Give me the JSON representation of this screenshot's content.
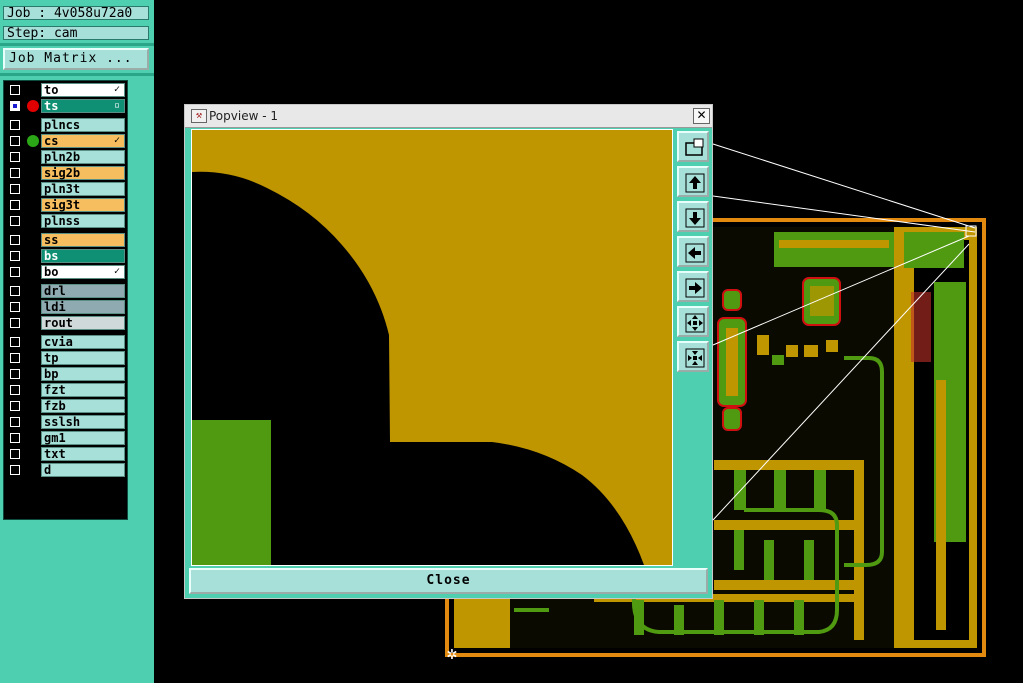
{
  "header": {
    "job": "Job : 4v058u72a0",
    "step": "Step: cam",
    "job_matrix_label": "Job Matrix ..."
  },
  "layers": [
    {
      "name": "to",
      "mark": "✓",
      "style": "sel",
      "dot": ""
    },
    {
      "name": "ts",
      "mark": "▫",
      "style": "teal",
      "dot": "#e00000",
      "checked": true
    },
    {
      "name": "plncs",
      "style": "board"
    },
    {
      "name": "cs",
      "mark": "✓",
      "style": "sig",
      "dot": "#2aa616"
    },
    {
      "name": "pln2b",
      "style": "board"
    },
    {
      "name": "sig2b",
      "style": "sig"
    },
    {
      "name": "pln3t",
      "style": "board"
    },
    {
      "name": "sig3t",
      "style": "sig"
    },
    {
      "name": "plnss",
      "style": "board"
    },
    {
      "name": "ss",
      "style": "sig"
    },
    {
      "name": "bs",
      "style": "teal"
    },
    {
      "name": "bo",
      "mark": "✓",
      "style": "sel"
    },
    {
      "name": "drl",
      "style": "gray"
    },
    {
      "name": "ldi",
      "style": "gray"
    },
    {
      "name": "rout",
      "style": "light"
    },
    {
      "name": "cvia",
      "style": "board"
    },
    {
      "name": "tp",
      "style": "board"
    },
    {
      "name": "bp",
      "style": "board"
    },
    {
      "name": "fzt",
      "style": "board"
    },
    {
      "name": "fzb",
      "style": "board"
    },
    {
      "name": "sslsh",
      "style": "board"
    },
    {
      "name": "gm1",
      "style": "board"
    },
    {
      "name": "txt",
      "style": "board"
    },
    {
      "name": "d",
      "style": "board"
    }
  ],
  "popview": {
    "title": "Popview - 1",
    "close_label": "Close",
    "tools": [
      "zoom-window-icon",
      "pan-up-icon",
      "pan-down-icon",
      "pan-left-icon",
      "pan-right-icon",
      "zoom-in-icon",
      "zoom-out-icon"
    ]
  },
  "colors": {
    "panel": "#4dcfb0",
    "copper": "#bf9500",
    "mask": "#4f9a10",
    "board_outline": "#e28a10"
  }
}
